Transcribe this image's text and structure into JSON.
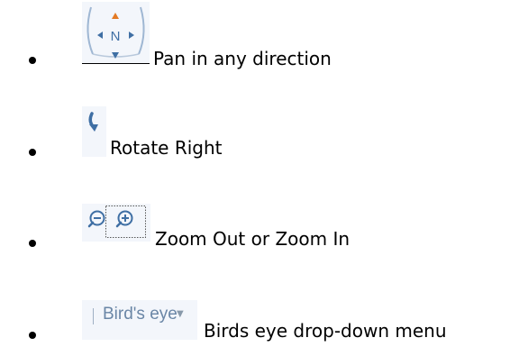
{
  "items": [
    {
      "icon": "compass-pan-icon",
      "label": "Pan in any direction",
      "icon_text": "N"
    },
    {
      "icon": "rotate-right-icon",
      "label": "Rotate Right"
    },
    {
      "icon": "zoom-buttons-icon",
      "label": "Zoom Out or Zoom In"
    },
    {
      "icon": "birds-eye-dropdown-icon",
      "label": "Birds eye drop-down menu",
      "icon_text": "Bird's eye"
    }
  ],
  "colors": {
    "icon_blue": "#3f6fa4",
    "accent_orange": "#e37a24",
    "icon_bg": "#f3f6fb"
  }
}
